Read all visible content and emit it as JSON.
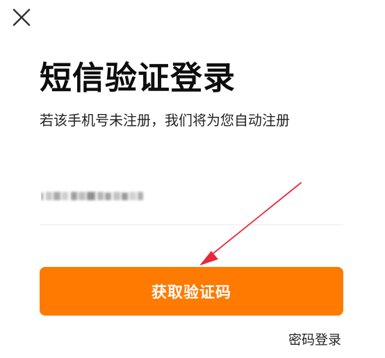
{
  "header": {
    "close_icon": "close-icon"
  },
  "main": {
    "title": "短信验证登录",
    "subtitle": "若该手机号未注册，我们将为您自动注册",
    "phone_input": {
      "value": "",
      "placeholder": ""
    },
    "submit_label": "获取验证码",
    "password_login_label": "密码登录"
  },
  "colors": {
    "accent": "#ff7a00",
    "annotation_arrow": "#e8283a"
  }
}
